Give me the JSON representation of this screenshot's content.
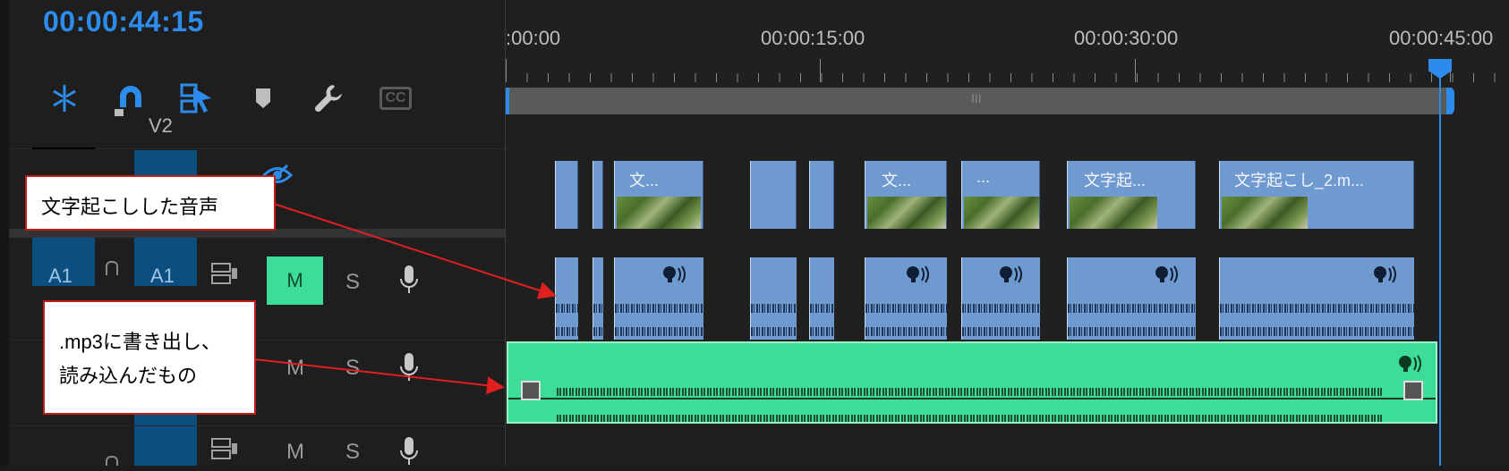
{
  "header": {
    "timecode": "00:00:44:15"
  },
  "ruler": {
    "labels": [
      ":00:00",
      "00:00:15:00",
      "00:00:30:00",
      "00:00:45:00"
    ],
    "scroll_grip": "III"
  },
  "toolbar": {
    "icons": [
      "snap-sequence-icon",
      "magnet-icon",
      "linked-selection-icon",
      "marker-icon",
      "wrench-icon",
      "captions-icon"
    ],
    "cc_label": "CC"
  },
  "tracks": {
    "v2_label": "V2",
    "a1_source_label": "A1",
    "a1_target_label": "A1",
    "mute_label": "M",
    "solo_label": "S"
  },
  "video_clips": [
    {
      "title": ""
    },
    {
      "title": ""
    },
    {
      "title": "文..."
    },
    {
      "title": ""
    },
    {
      "title": ""
    },
    {
      "title": "文..."
    },
    {
      "title": "..."
    },
    {
      "title": "文字起..."
    },
    {
      "title": "文字起こし_2.m..."
    }
  ],
  "callouts": {
    "transcribed_audio": "文字起こしした音声",
    "mp3_line1": ".mp3に書き出し、",
    "mp3_line2": "読み込んだもの"
  },
  "colors": {
    "accent": "#2d8ceb",
    "clip_blue": "#6f9ad0",
    "audio_green": "#3ddc97",
    "annotation_red": "#c61a1a"
  }
}
